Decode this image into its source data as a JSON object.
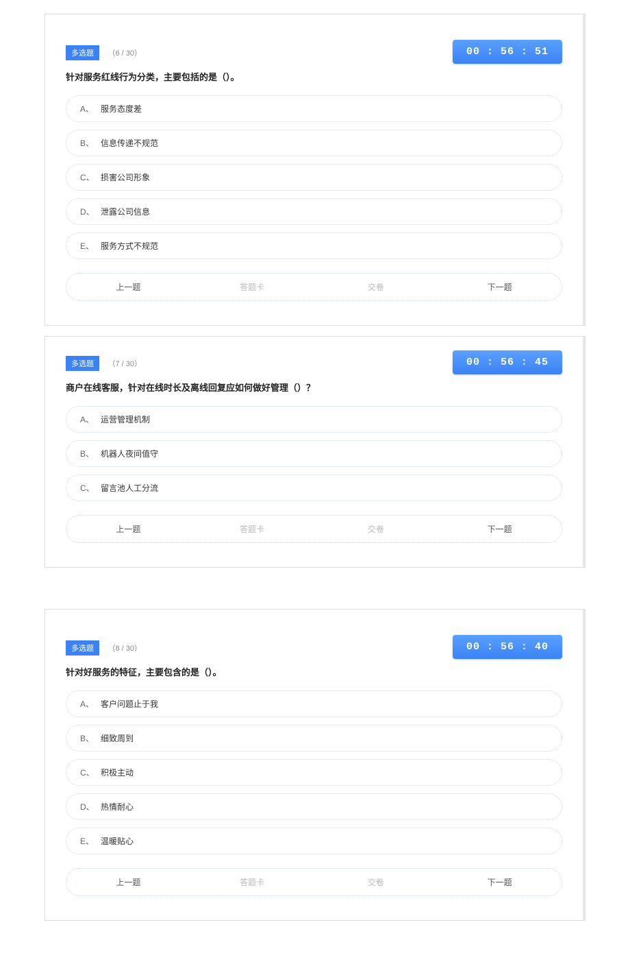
{
  "common": {
    "badge_label": "多选题",
    "nav": {
      "prev": "上一题",
      "card": "答题卡",
      "submit": "交卷",
      "next": "下一题"
    },
    "letters": {
      "A": "A、",
      "B": "B、",
      "C": "C、",
      "D": "D、",
      "E": "E、"
    }
  },
  "q1": {
    "counter": "（6 / 30）",
    "timer": "00 : 56 : 51",
    "question": "针对服务红线行为分类，主要包括的是（）。",
    "options": {
      "A": "服务态度差",
      "B": "信息传递不规范",
      "C": "损害公司形象",
      "D": "泄露公司信息",
      "E": "服务方式不规范"
    }
  },
  "q2": {
    "counter": "（7 / 30）",
    "timer": "00 : 56 : 45",
    "question": "商户在线客服，针对在线时长及离线回复应如何做好管理（）？",
    "options": {
      "A": "运营管理机制",
      "B": "机器人夜间值守",
      "C": "留言池人工分流"
    }
  },
  "q3": {
    "counter": "（8 / 30）",
    "timer": "00 : 56 : 40",
    "question": "针对好服务的特征，主要包含的是（）。",
    "options": {
      "A": "客户问题止于我",
      "B": "细致周到",
      "C": "积极主动",
      "D": "热情耐心",
      "E": "温暖贴心"
    }
  }
}
